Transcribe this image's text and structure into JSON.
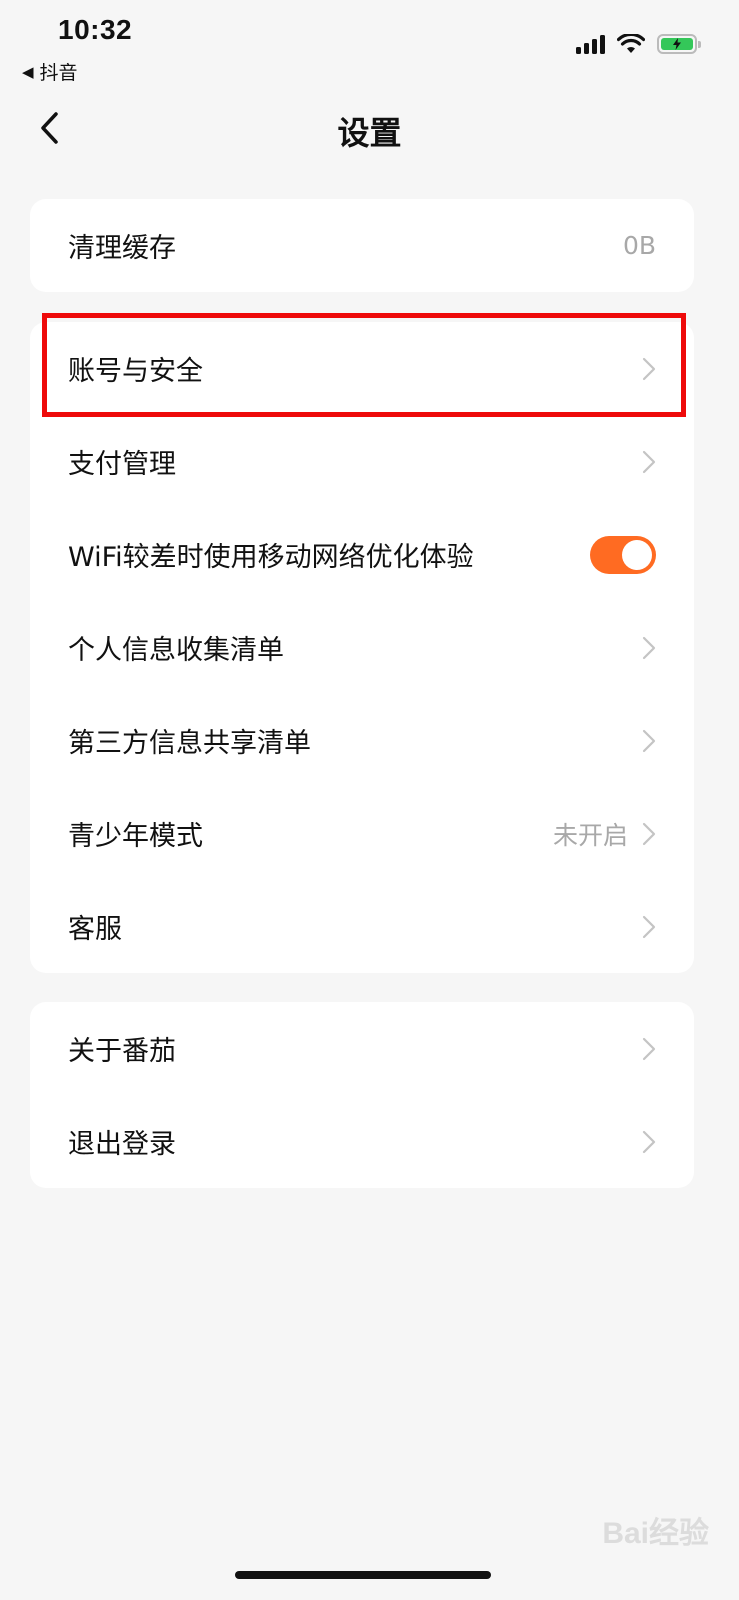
{
  "status_bar": {
    "time": "10:32",
    "back_app": "抖音"
  },
  "header": {
    "title": "设置"
  },
  "card1": [
    {
      "label": "清理缓存",
      "value": "0B"
    }
  ],
  "card2": [
    {
      "label": "账号与安全"
    },
    {
      "label": "支付管理"
    },
    {
      "label": "WiFi较差时使用移动网络优化体验",
      "toggle_on": true
    },
    {
      "label": "个人信息收集清单"
    },
    {
      "label": "第三方信息共享清单"
    },
    {
      "label": "青少年模式",
      "value": "未开启"
    },
    {
      "label": "客服"
    }
  ],
  "card3": [
    {
      "label": "关于番茄"
    },
    {
      "label": "退出登录"
    }
  ],
  "accent_color": "#ff6b22",
  "highlight_color": "#ee0a0a",
  "watermark": "Bai经验"
}
